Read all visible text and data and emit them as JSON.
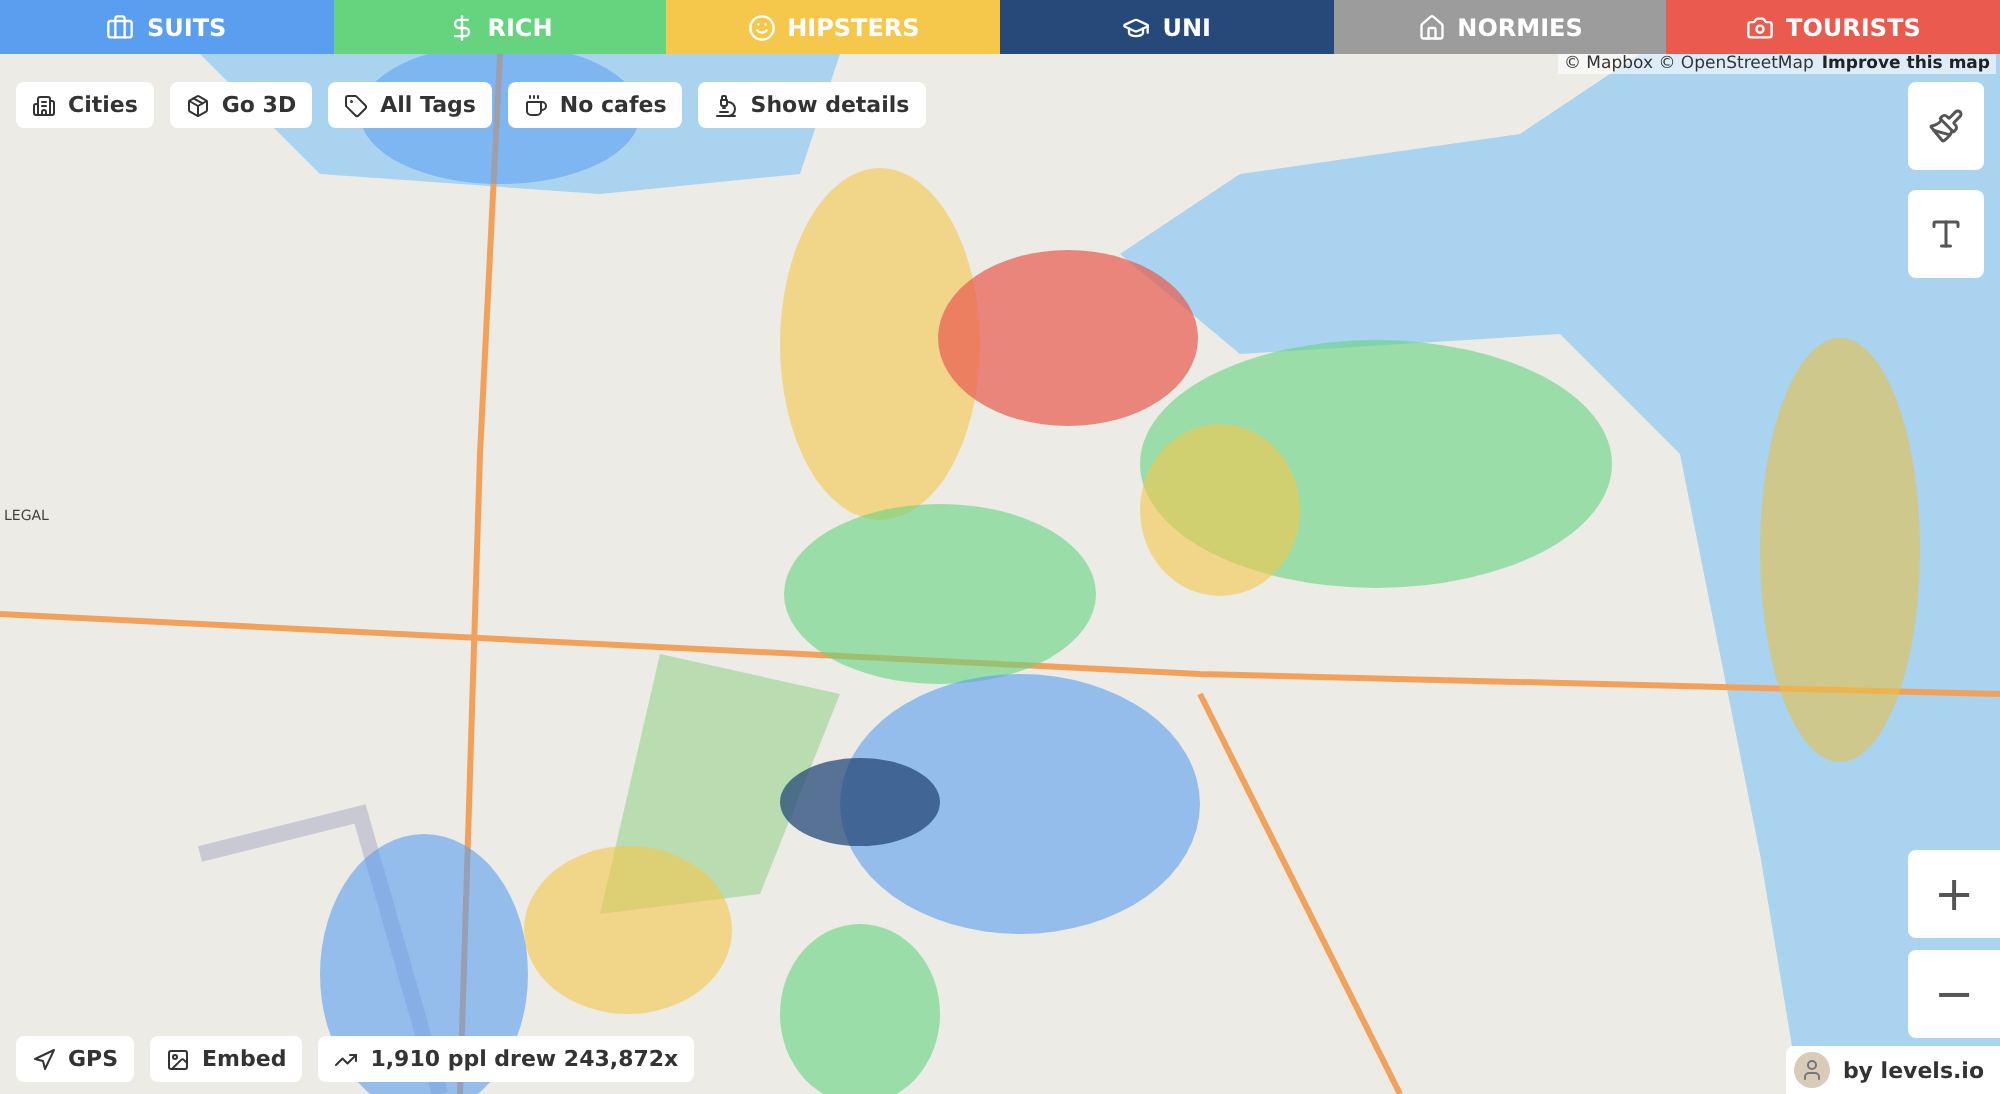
{
  "tabs": [
    {
      "label": "SUITS",
      "kind": "suit",
      "color": "#5a9ef0",
      "selected": false
    },
    {
      "label": "RICH",
      "kind": "money",
      "color": "#66d37e",
      "selected": false
    },
    {
      "label": "HIPSTERS",
      "kind": "beard",
      "color": "#f5c84c",
      "selected": false
    },
    {
      "label": "UNI",
      "kind": "grad",
      "color": "#26497a",
      "selected": false
    },
    {
      "label": "NORMIES",
      "kind": "house",
      "color": "#9c9c9c",
      "selected": false
    },
    {
      "label": "TOURISTS",
      "kind": "camera",
      "color": "#ea5a4e",
      "selected": false
    }
  ],
  "map_controls": [
    {
      "label": "Cities",
      "kind": "city"
    },
    {
      "label": "Go 3D",
      "kind": "box"
    },
    {
      "label": "All Tags",
      "kind": "tag"
    },
    {
      "label": "No cafes",
      "kind": "cup"
    },
    {
      "label": "Show details",
      "kind": "scope"
    }
  ],
  "legal": "LEGAL",
  "attribution": {
    "credits": "© Mapbox © OpenStreetMap",
    "link": "Improve this map"
  },
  "tools": [
    {
      "kind": "brush"
    },
    {
      "kind": "text"
    }
  ],
  "zoom": [
    "+",
    "−"
  ],
  "footer_controls": [
    {
      "label": "GPS",
      "kind": "gps"
    },
    {
      "label": "Embed",
      "kind": "picture"
    },
    {
      "label": "1,910 ppl drew 243,872x",
      "kind": "chart"
    }
  ],
  "author": "by levels.io"
}
